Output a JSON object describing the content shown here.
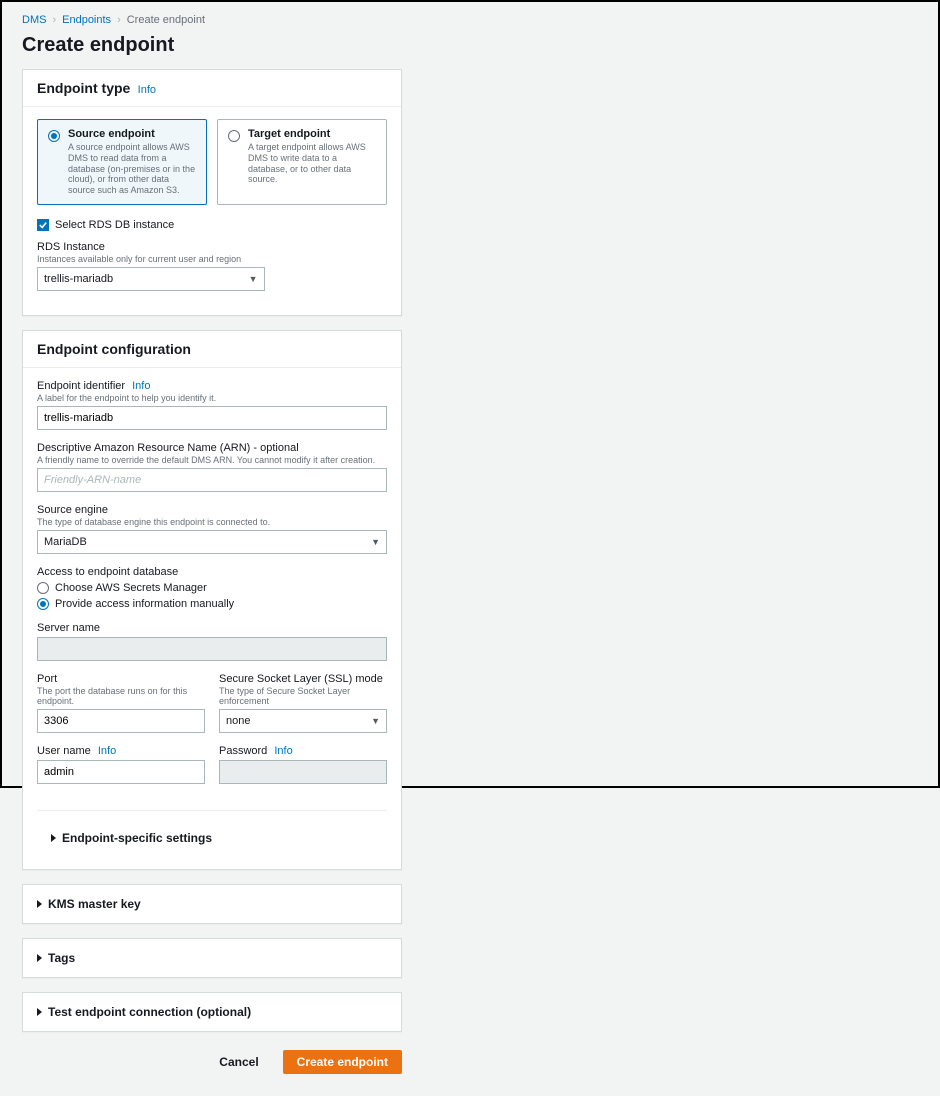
{
  "breadcrumbs": {
    "dms": "DMS",
    "endpoints": "Endpoints",
    "create": "Create endpoint"
  },
  "page_title": "Create endpoint",
  "info_label": "Info",
  "endpoint_type": {
    "heading": "Endpoint type",
    "source": {
      "title": "Source endpoint",
      "desc": "A source endpoint allows AWS DMS to read data from a database (on-premises or in the cloud), or from other data source such as Amazon S3."
    },
    "target": {
      "title": "Target endpoint",
      "desc": "A target endpoint allows AWS DMS to write data to a database, or to other data source."
    },
    "select_rds": "Select RDS DB instance",
    "rds_instance": {
      "label": "RDS Instance",
      "hint": "Instances available only for current user and region",
      "value": "trellis-mariadb"
    }
  },
  "config": {
    "heading": "Endpoint configuration",
    "identifier": {
      "label": "Endpoint identifier",
      "hint": "A label for the endpoint to help you identify it.",
      "value": "trellis-mariadb"
    },
    "arn": {
      "label": "Descriptive Amazon Resource Name (ARN) - optional",
      "hint": "A friendly name to override the default DMS ARN. You cannot modify it after creation.",
      "placeholder": "Friendly-ARN-name"
    },
    "engine": {
      "label": "Source engine",
      "hint": "The type of database engine this endpoint is connected to.",
      "value": "MariaDB"
    },
    "access": {
      "label": "Access to endpoint database",
      "opt1": "Choose AWS Secrets Manager",
      "opt2": "Provide access information manually"
    },
    "server": {
      "label": "Server name",
      "value": ""
    },
    "port": {
      "label": "Port",
      "hint": "The port the database runs on for this endpoint.",
      "value": "3306"
    },
    "ssl": {
      "label": "Secure Socket Layer (SSL) mode",
      "hint": "The type of Secure Socket Layer enforcement",
      "value": "none"
    },
    "user": {
      "label": "User name",
      "value": "admin"
    },
    "password": {
      "label": "Password",
      "value": ""
    },
    "endpoint_specific": "Endpoint-specific settings"
  },
  "kms": "KMS master key",
  "tags": "Tags",
  "test": "Test endpoint connection (optional)",
  "actions": {
    "cancel": "Cancel",
    "create": "Create endpoint"
  }
}
